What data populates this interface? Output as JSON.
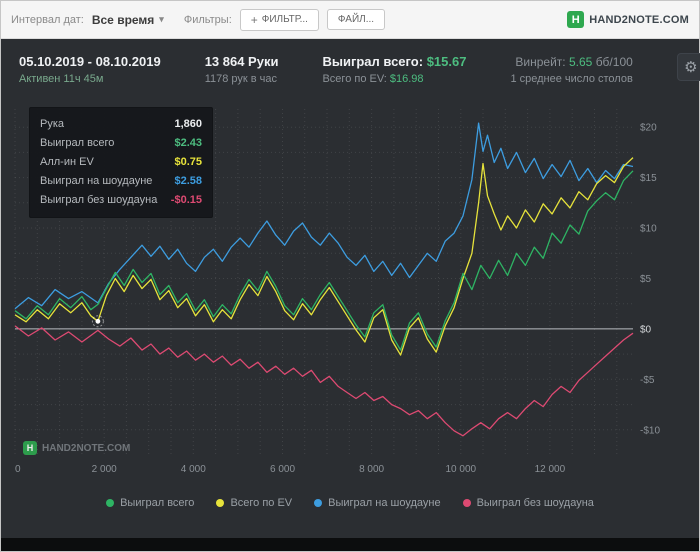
{
  "toolbar": {
    "date_interval_label": "Интервал дат:",
    "date_interval_value": "Все время",
    "filters_label": "Фильтры:",
    "filter_button": "ФИЛЬТР...",
    "file_button": "ФАЙЛ...",
    "logo_letter": "H",
    "brand": "HAND2NOTE.COM"
  },
  "icons": {
    "caret_down": "▾",
    "plus": "+",
    "gear": "⚙"
  },
  "header": {
    "date_range": "05.10.2019 - 08.10.2019",
    "active_time": "Активен 11ч 45м",
    "hands": "13 864 Руки",
    "hands_per_hour": "1178 рук в час",
    "won_total_label": "Выиграл всего:",
    "won_total_value": "$15.67",
    "ev_total_label": "Всего по EV:",
    "ev_total_value": "$16.98",
    "winrate_label": "Винрейт:",
    "winrate_value": "5.65",
    "winrate_suffix": "бб/100",
    "avg_tables": "1 среднее число столов"
  },
  "tooltip": {
    "rows": [
      {
        "label": "Рука",
        "value": "1,860",
        "color": "#eceef0"
      },
      {
        "label": "Выиграл всего",
        "value": "$2.43",
        "color": "#4dbd80"
      },
      {
        "label": "Алл-ин EV",
        "value": "$0.75",
        "color": "#e7e33b"
      },
      {
        "label": "Выиграл на шоудауне",
        "value": "$2.58",
        "color": "#3d9de0"
      },
      {
        "label": "Выиграл без шоудауна",
        "value": "-$0.15",
        "color": "#dd4a72"
      }
    ]
  },
  "watermark": {
    "logo_letter": "H",
    "text": "HAND2NOTE.COM"
  },
  "chart_data": {
    "type": "line",
    "xlim": [
      0,
      13864
    ],
    "ylim": [
      -12.5,
      21.8
    ],
    "grid": {
      "x_step": 500,
      "y_step": 2.5
    },
    "x_tick_values": [
      0,
      2000,
      4000,
      6000,
      8000,
      10000,
      12000
    ],
    "x_tick_labels": [
      "0",
      "2 000",
      "4 000",
      "6 000",
      "8 000",
      "10 000",
      "12 000"
    ],
    "y_tick_values": [
      20,
      15,
      10,
      5,
      0,
      -5,
      -10
    ],
    "y_tick_labels": [
      "$20",
      "$15",
      "$10",
      "$5",
      "$0",
      "-$5",
      "-$10"
    ],
    "marker": {
      "x": 1860,
      "y": 0.75
    },
    "series": [
      {
        "id": "won-total",
        "name": "Выиграл всего",
        "color": "#2eb464",
        "points": [
          [
            0,
            1.8
          ],
          [
            250,
            1.0
          ],
          [
            500,
            2.3
          ],
          [
            750,
            1.4
          ],
          [
            1000,
            3.0
          ],
          [
            1250,
            2.1
          ],
          [
            1500,
            3.2
          ],
          [
            1700,
            1.9
          ],
          [
            1860,
            2.43
          ],
          [
            2050,
            4.0
          ],
          [
            2250,
            5.6
          ],
          [
            2450,
            4.3
          ],
          [
            2650,
            5.9
          ],
          [
            2850,
            4.6
          ],
          [
            3050,
            5.5
          ],
          [
            3250,
            3.4
          ],
          [
            3450,
            4.3
          ],
          [
            3650,
            2.6
          ],
          [
            3850,
            3.5
          ],
          [
            4050,
            1.8
          ],
          [
            4250,
            2.9
          ],
          [
            4450,
            1.2
          ],
          [
            4650,
            2.4
          ],
          [
            4850,
            1.5
          ],
          [
            5050,
            3.4
          ],
          [
            5250,
            4.9
          ],
          [
            5450,
            3.8
          ],
          [
            5650,
            5.7
          ],
          [
            5850,
            4.2
          ],
          [
            6050,
            2.3
          ],
          [
            6250,
            1.4
          ],
          [
            6450,
            3.0
          ],
          [
            6650,
            1.9
          ],
          [
            6850,
            3.4
          ],
          [
            7050,
            4.6
          ],
          [
            7250,
            3.2
          ],
          [
            7450,
            1.8
          ],
          [
            7650,
            0.4
          ],
          [
            7850,
            -0.8
          ],
          [
            8050,
            1.6
          ],
          [
            8250,
            2.4
          ],
          [
            8450,
            -0.6
          ],
          [
            8650,
            -2.1
          ],
          [
            8850,
            0.6
          ],
          [
            9050,
            1.6
          ],
          [
            9250,
            -0.5
          ],
          [
            9450,
            -1.8
          ],
          [
            9650,
            0.8
          ],
          [
            9850,
            2.6
          ],
          [
            10050,
            5.5
          ],
          [
            10250,
            3.9
          ],
          [
            10450,
            6.3
          ],
          [
            10650,
            5.0
          ],
          [
            10850,
            6.8
          ],
          [
            11050,
            5.3
          ],
          [
            11250,
            7.5
          ],
          [
            11450,
            6.3
          ],
          [
            11650,
            8.1
          ],
          [
            11850,
            7.0
          ],
          [
            12050,
            9.5
          ],
          [
            12250,
            8.5
          ],
          [
            12450,
            10.3
          ],
          [
            12650,
            9.4
          ],
          [
            12850,
            11.7
          ],
          [
            13050,
            12.7
          ],
          [
            13250,
            13.5
          ],
          [
            13450,
            12.8
          ],
          [
            13650,
            14.7
          ],
          [
            13864,
            15.67
          ]
        ]
      },
      {
        "id": "ev-total",
        "name": "Всего по EV",
        "color": "#e7e33b",
        "points": [
          [
            0,
            1.4
          ],
          [
            250,
            0.7
          ],
          [
            500,
            1.9
          ],
          [
            750,
            1.0
          ],
          [
            1000,
            2.5
          ],
          [
            1250,
            1.6
          ],
          [
            1500,
            2.6
          ],
          [
            1700,
            1.3
          ],
          [
            1860,
            0.75
          ],
          [
            2050,
            3.3
          ],
          [
            2250,
            5.0
          ],
          [
            2450,
            3.7
          ],
          [
            2650,
            5.3
          ],
          [
            2850,
            4.0
          ],
          [
            3050,
            4.9
          ],
          [
            3250,
            2.9
          ],
          [
            3450,
            3.8
          ],
          [
            3650,
            2.1
          ],
          [
            3850,
            3.0
          ],
          [
            4050,
            1.3
          ],
          [
            4250,
            2.4
          ],
          [
            4450,
            0.7
          ],
          [
            4650,
            1.9
          ],
          [
            4850,
            1.0
          ],
          [
            5050,
            2.9
          ],
          [
            5250,
            4.4
          ],
          [
            5450,
            3.3
          ],
          [
            5650,
            5.2
          ],
          [
            5850,
            3.7
          ],
          [
            6050,
            1.8
          ],
          [
            6250,
            0.9
          ],
          [
            6450,
            2.5
          ],
          [
            6650,
            1.4
          ],
          [
            6850,
            2.9
          ],
          [
            7050,
            4.1
          ],
          [
            7250,
            2.7
          ],
          [
            7450,
            1.3
          ],
          [
            7650,
            -0.1
          ],
          [
            7850,
            -1.3
          ],
          [
            8050,
            1.1
          ],
          [
            8250,
            1.9
          ],
          [
            8450,
            -1.1
          ],
          [
            8650,
            -2.6
          ],
          [
            8850,
            0.1
          ],
          [
            9050,
            1.1
          ],
          [
            9250,
            -1.0
          ],
          [
            9450,
            -2.3
          ],
          [
            9650,
            0.3
          ],
          [
            9850,
            2.1
          ],
          [
            10050,
            5.0
          ],
          [
            10250,
            7.5
          ],
          [
            10400,
            12.5
          ],
          [
            10500,
            16.4
          ],
          [
            10600,
            13.2
          ],
          [
            10750,
            11.4
          ],
          [
            10900,
            9.8
          ],
          [
            11050,
            11.2
          ],
          [
            11250,
            10.0
          ],
          [
            11450,
            11.8
          ],
          [
            11650,
            10.6
          ],
          [
            11850,
            12.4
          ],
          [
            12050,
            11.4
          ],
          [
            12250,
            13.0
          ],
          [
            12450,
            12.0
          ],
          [
            12650,
            13.6
          ],
          [
            12850,
            12.8
          ],
          [
            13050,
            14.4
          ],
          [
            13250,
            15.2
          ],
          [
            13450,
            14.5
          ],
          [
            13650,
            16.1
          ],
          [
            13864,
            16.98
          ]
        ]
      },
      {
        "id": "showdown",
        "name": "Выиграл на шоудауне",
        "color": "#3d9de0",
        "points": [
          [
            0,
            2.0
          ],
          [
            300,
            3.1
          ],
          [
            600,
            2.3
          ],
          [
            900,
            3.9
          ],
          [
            1200,
            3.0
          ],
          [
            1500,
            3.7
          ],
          [
            1860,
            2.58
          ],
          [
            2100,
            4.5
          ],
          [
            2350,
            5.9
          ],
          [
            2600,
            7.1
          ],
          [
            2850,
            8.3
          ],
          [
            3050,
            7.2
          ],
          [
            3250,
            8.2
          ],
          [
            3450,
            6.9
          ],
          [
            3650,
            7.9
          ],
          [
            3850,
            6.5
          ],
          [
            4050,
            5.7
          ],
          [
            4250,
            7.1
          ],
          [
            4450,
            7.9
          ],
          [
            4650,
            6.7
          ],
          [
            4850,
            8.1
          ],
          [
            5050,
            9.0
          ],
          [
            5250,
            8.1
          ],
          [
            5450,
            9.5
          ],
          [
            5650,
            10.7
          ],
          [
            5850,
            9.3
          ],
          [
            6050,
            8.3
          ],
          [
            6250,
            9.7
          ],
          [
            6450,
            10.5
          ],
          [
            6650,
            9.1
          ],
          [
            6850,
            8.3
          ],
          [
            7050,
            9.5
          ],
          [
            7250,
            8.5
          ],
          [
            7450,
            7.1
          ],
          [
            7650,
            6.3
          ],
          [
            7850,
            7.3
          ],
          [
            8050,
            5.7
          ],
          [
            8250,
            6.7
          ],
          [
            8450,
            5.3
          ],
          [
            8650,
            6.5
          ],
          [
            8850,
            5.1
          ],
          [
            9050,
            6.3
          ],
          [
            9250,
            7.5
          ],
          [
            9450,
            6.7
          ],
          [
            9650,
            8.7
          ],
          [
            9850,
            9.5
          ],
          [
            10050,
            11.2
          ],
          [
            10250,
            14.8
          ],
          [
            10400,
            20.4
          ],
          [
            10500,
            17.6
          ],
          [
            10600,
            19.2
          ],
          [
            10750,
            16.5
          ],
          [
            10900,
            17.9
          ],
          [
            11050,
            15.9
          ],
          [
            11250,
            17.5
          ],
          [
            11450,
            15.5
          ],
          [
            11650,
            16.9
          ],
          [
            11850,
            14.9
          ],
          [
            12050,
            16.3
          ],
          [
            12250,
            15.1
          ],
          [
            12450,
            16.7
          ],
          [
            12650,
            14.7
          ],
          [
            12850,
            15.9
          ],
          [
            13050,
            14.5
          ],
          [
            13250,
            15.7
          ],
          [
            13450,
            14.9
          ],
          [
            13650,
            16.3
          ],
          [
            13864,
            16.1
          ]
        ]
      },
      {
        "id": "non-showdown",
        "name": "Выиграл без шоудауна",
        "color": "#dd4a72",
        "points": [
          [
            0,
            0.3
          ],
          [
            300,
            -0.7
          ],
          [
            600,
            0.1
          ],
          [
            900,
            -1.1
          ],
          [
            1200,
            -0.3
          ],
          [
            1500,
            -1.3
          ],
          [
            1860,
            -0.15
          ],
          [
            2100,
            -1.0
          ],
          [
            2350,
            -1.7
          ],
          [
            2600,
            -0.9
          ],
          [
            2850,
            -2.1
          ],
          [
            3050,
            -1.5
          ],
          [
            3250,
            -2.5
          ],
          [
            3450,
            -1.9
          ],
          [
            3650,
            -2.8
          ],
          [
            3850,
            -2.2
          ],
          [
            4050,
            -3.1
          ],
          [
            4250,
            -2.5
          ],
          [
            4450,
            -3.3
          ],
          [
            4650,
            -2.7
          ],
          [
            4850,
            -3.6
          ],
          [
            5050,
            -3.0
          ],
          [
            5250,
            -3.9
          ],
          [
            5450,
            -3.3
          ],
          [
            5650,
            -4.3
          ],
          [
            5850,
            -3.7
          ],
          [
            6050,
            -4.5
          ],
          [
            6250,
            -3.9
          ],
          [
            6450,
            -4.7
          ],
          [
            6650,
            -4.1
          ],
          [
            6850,
            -5.3
          ],
          [
            7050,
            -4.7
          ],
          [
            7250,
            -5.7
          ],
          [
            7450,
            -6.3
          ],
          [
            7650,
            -6.9
          ],
          [
            7850,
            -6.3
          ],
          [
            8050,
            -7.1
          ],
          [
            8250,
            -6.7
          ],
          [
            8450,
            -7.5
          ],
          [
            8650,
            -7.9
          ],
          [
            8850,
            -8.5
          ],
          [
            9050,
            -8.1
          ],
          [
            9250,
            -8.9
          ],
          [
            9450,
            -8.3
          ],
          [
            9650,
            -9.3
          ],
          [
            9850,
            -10.1
          ],
          [
            10050,
            -10.6
          ],
          [
            10250,
            -9.9
          ],
          [
            10450,
            -9.3
          ],
          [
            10650,
            -9.9
          ],
          [
            10850,
            -8.9
          ],
          [
            11050,
            -8.3
          ],
          [
            11250,
            -8.9
          ],
          [
            11450,
            -7.9
          ],
          [
            11650,
            -7.1
          ],
          [
            11850,
            -7.7
          ],
          [
            12050,
            -6.5
          ],
          [
            12250,
            -5.7
          ],
          [
            12450,
            -6.3
          ],
          [
            12650,
            -5.1
          ],
          [
            12850,
            -4.3
          ],
          [
            13050,
            -3.5
          ],
          [
            13250,
            -2.7
          ],
          [
            13450,
            -1.9
          ],
          [
            13650,
            -1.1
          ],
          [
            13864,
            -0.43
          ]
        ]
      }
    ]
  }
}
